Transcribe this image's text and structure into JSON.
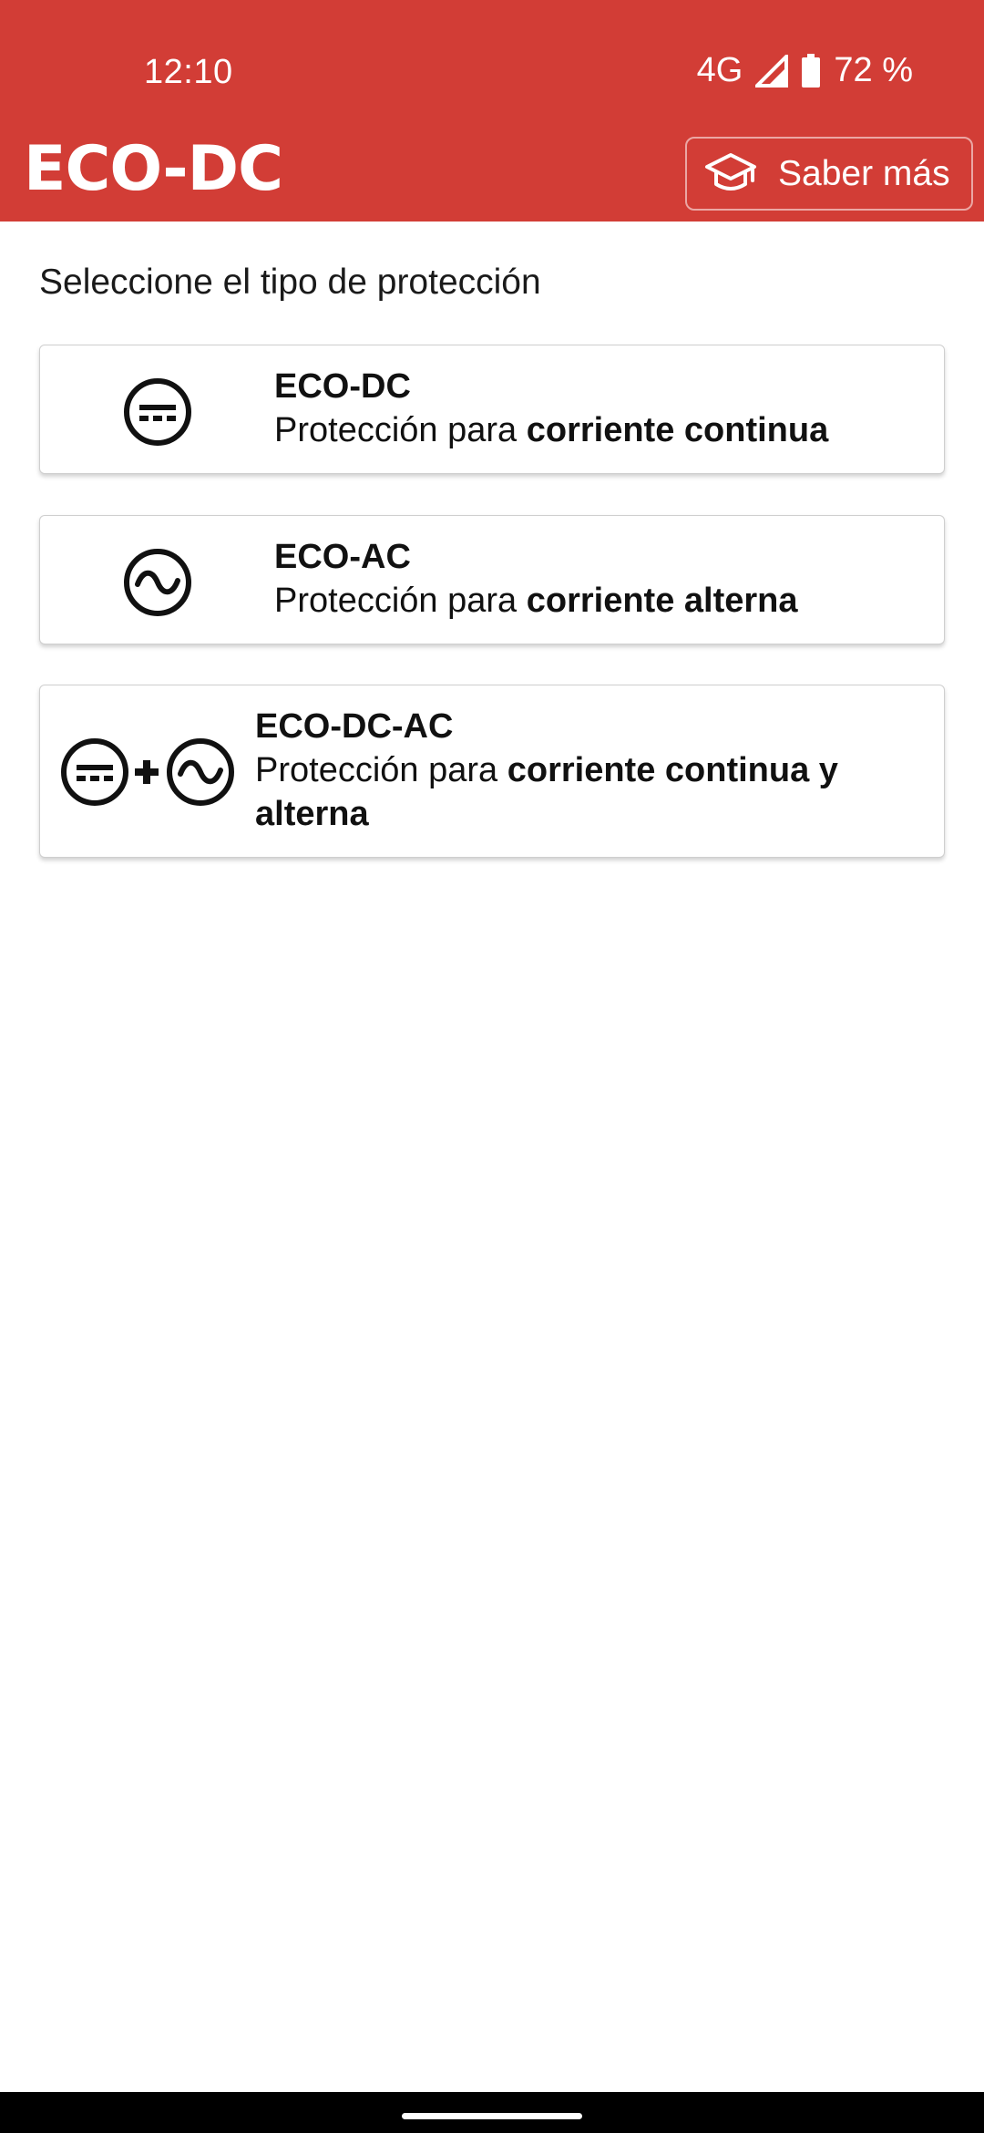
{
  "status": {
    "time": "12:10",
    "network": "4G",
    "battery": "72 %"
  },
  "appbar": {
    "title": "ECO-DC",
    "learn_more_label": "Saber más",
    "learn_more_icon": "graduation-cap-icon"
  },
  "main": {
    "prompt": "Seleccione el tipo de protección",
    "options": [
      {
        "title": "ECO-DC",
        "desc_prefix": "Protección para ",
        "desc_bold": "corriente continua",
        "icon": "dc-circle-icon"
      },
      {
        "title": "ECO-AC",
        "desc_prefix": "Protección para ",
        "desc_bold": "corriente alterna",
        "icon": "ac-circle-icon"
      },
      {
        "title": "ECO-DC-AC",
        "desc_prefix": "Protección para ",
        "desc_bold": "corriente continua y alterna",
        "icon": "dc-plus-ac-icon"
      }
    ]
  },
  "colors": {
    "brand": "#d23d36",
    "text": "#111111"
  }
}
